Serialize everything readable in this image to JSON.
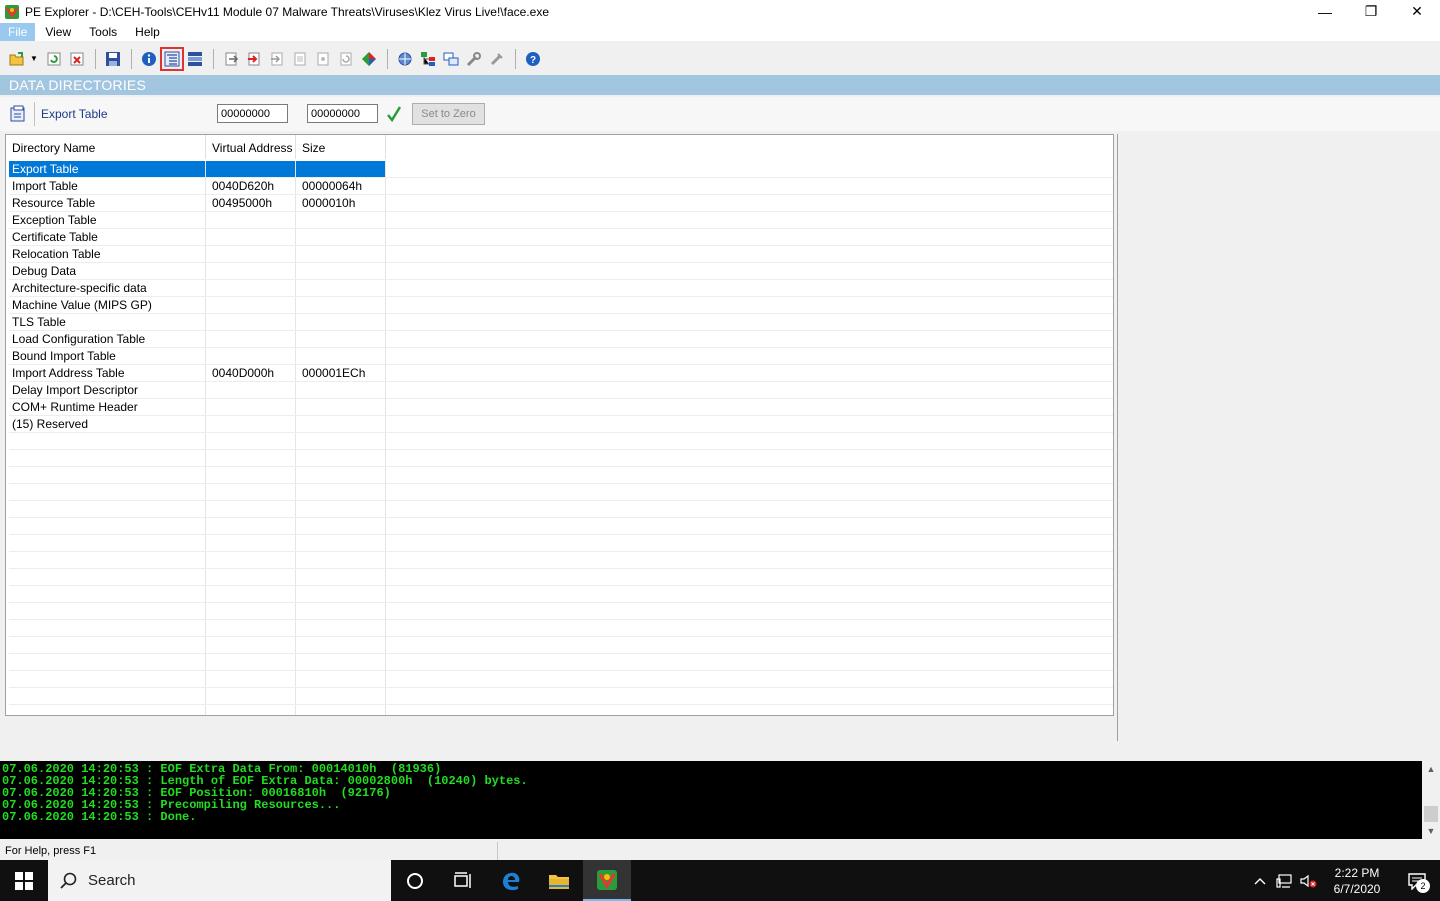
{
  "window": {
    "title": "PE Explorer - D:\\CEH-Tools\\CEHv11 Module 07 Malware Threats\\Viruses\\Klez Virus Live!\\face.exe",
    "minimize": "—",
    "restore": "❐",
    "close": "✕"
  },
  "menu": {
    "items": [
      "File",
      "View",
      "Tools",
      "Help"
    ]
  },
  "section": {
    "title": "DATA DIRECTORIES"
  },
  "editor": {
    "label": "Export Table",
    "virtual_address": "00000000",
    "size": "00000000",
    "set_zero_label": "Set to Zero"
  },
  "table": {
    "headers": [
      "Directory Name",
      "Virtual Address",
      "Size"
    ],
    "rows": [
      {
        "name": "Export Table",
        "va": "",
        "size": "",
        "selected": true
      },
      {
        "name": "Import Table",
        "va": "0040D620h",
        "size": "00000064h"
      },
      {
        "name": "Resource Table",
        "va": "00495000h",
        "size": "0000010h"
      },
      {
        "name": "Exception Table",
        "va": "",
        "size": ""
      },
      {
        "name": "Certificate Table",
        "va": "",
        "size": ""
      },
      {
        "name": "Relocation Table",
        "va": "",
        "size": ""
      },
      {
        "name": "Debug Data",
        "va": "",
        "size": ""
      },
      {
        "name": "Architecture-specific data",
        "va": "",
        "size": ""
      },
      {
        "name": "Machine Value (MIPS GP)",
        "va": "",
        "size": ""
      },
      {
        "name": "TLS Table",
        "va": "",
        "size": ""
      },
      {
        "name": "Load Configuration Table",
        "va": "",
        "size": ""
      },
      {
        "name": "Bound Import Table",
        "va": "",
        "size": ""
      },
      {
        "name": "Import Address Table",
        "va": "0040D000h",
        "size": "000001ECh"
      },
      {
        "name": "Delay Import Descriptor",
        "va": "",
        "size": ""
      },
      {
        "name": "COM+ Runtime Header",
        "va": "",
        "size": ""
      },
      {
        "name": "(15) Reserved",
        "va": "",
        "size": ""
      }
    ],
    "empty_rows": 17
  },
  "log": {
    "lines": [
      "07.06.2020 14:20:53 : EOF Extra Data From: 00014010h  (81936)",
      "07.06.2020 14:20:53 : Length of EOF Extra Data: 00002800h  (10240) bytes.",
      "07.06.2020 14:20:53 : EOF Position: 00016810h  (92176)",
      "07.06.2020 14:20:53 : Precompiling Resources...",
      "07.06.2020 14:20:53 : Done."
    ]
  },
  "status": {
    "help_text": "For Help, press F1"
  },
  "taskbar": {
    "search_placeholder": "Search",
    "time": "2:22 PM",
    "date": "6/7/2020",
    "notification_count": "2"
  },
  "colors": {
    "accent": "#0078d7",
    "section_header": "#a3c6e0",
    "log_text": "#22dd22",
    "highlight_outline": "#dd3333"
  }
}
